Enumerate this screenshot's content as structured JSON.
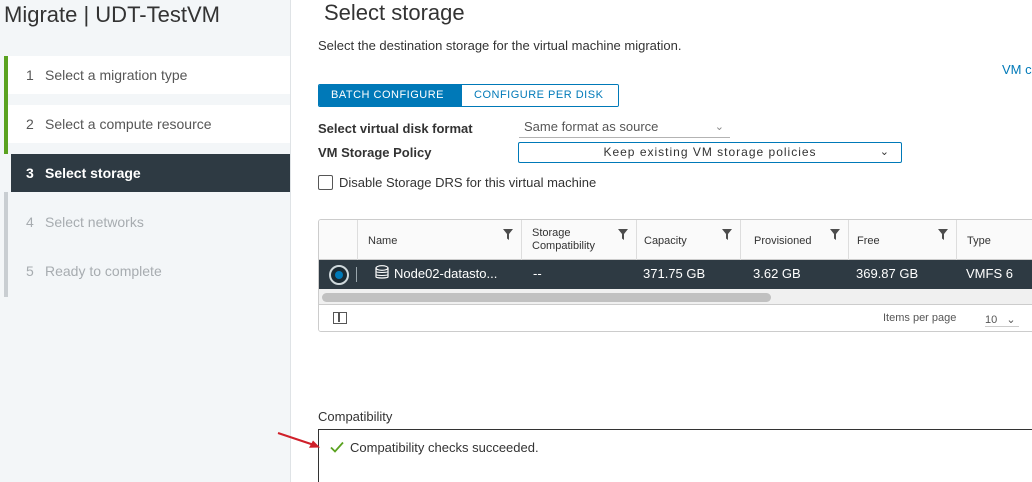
{
  "wizard": {
    "title": "Migrate | UDT-TestVM",
    "steps": [
      {
        "num": "1",
        "label": "Select a migration type",
        "state": "done"
      },
      {
        "num": "2",
        "label": "Select a compute resource",
        "state": "done"
      },
      {
        "num": "3",
        "label": "Select storage",
        "state": "active"
      },
      {
        "num": "4",
        "label": "Select networks",
        "state": "future"
      },
      {
        "num": "5",
        "label": "Ready to complete",
        "state": "future"
      }
    ]
  },
  "main": {
    "title": "Select storage",
    "description": "Select the destination storage for the virtual machine migration.",
    "vm_link": "VM c",
    "tabs": {
      "batch": "BATCH CONFIGURE",
      "per_disk": "CONFIGURE PER DISK"
    },
    "disk_format": {
      "label": "Select virtual disk format",
      "value": "Same format as source"
    },
    "storage_policy": {
      "label": "VM Storage Policy",
      "value": "Keep existing VM storage policies"
    },
    "disable_drs": {
      "label": "Disable Storage DRS for this virtual machine",
      "checked": false
    }
  },
  "grid": {
    "columns": [
      "Name",
      "Storage Compatibility",
      "Capacity",
      "Provisioned",
      "Free",
      "Type"
    ],
    "rows": [
      {
        "name": "Node02-datasto...",
        "compatibility": "--",
        "capacity": "371.75 GB",
        "provisioned": "3.62 GB",
        "free": "369.87 GB",
        "type": "VMFS 6",
        "selected": true
      }
    ],
    "footer": {
      "items_per_page_label": "Items per page",
      "items_per_page": "10"
    }
  },
  "compatibility": {
    "label": "Compatibility",
    "message": "Compatibility checks succeeded."
  },
  "colors": {
    "accent": "#0079b8",
    "sidebar_active": "#2e3a43",
    "step_done": "#5aa220",
    "success": "#5aa220",
    "annotation_arrow": "#d0202a"
  },
  "icons": [
    "datastore-icon",
    "filter-icon",
    "column-toggle-icon",
    "chevron-down-icon",
    "checkmark-icon",
    "annotation-arrow"
  ]
}
